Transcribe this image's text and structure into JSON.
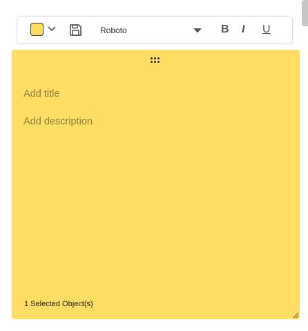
{
  "toolbar": {
    "note_color": "#fddd64",
    "font_family_value": "Roboto",
    "bold_label": "B",
    "italic_label": "I",
    "underline_label": "U"
  },
  "note": {
    "background_color": "#fddd64",
    "title_placeholder": "Add title",
    "description_placeholder": "Add description",
    "status_text": "1 Selected Object(s)"
  },
  "icons": [
    "chevron-down-icon",
    "save-icon",
    "caret-down-icon",
    "drag-handle-icon",
    "resize-grip-icon"
  ]
}
